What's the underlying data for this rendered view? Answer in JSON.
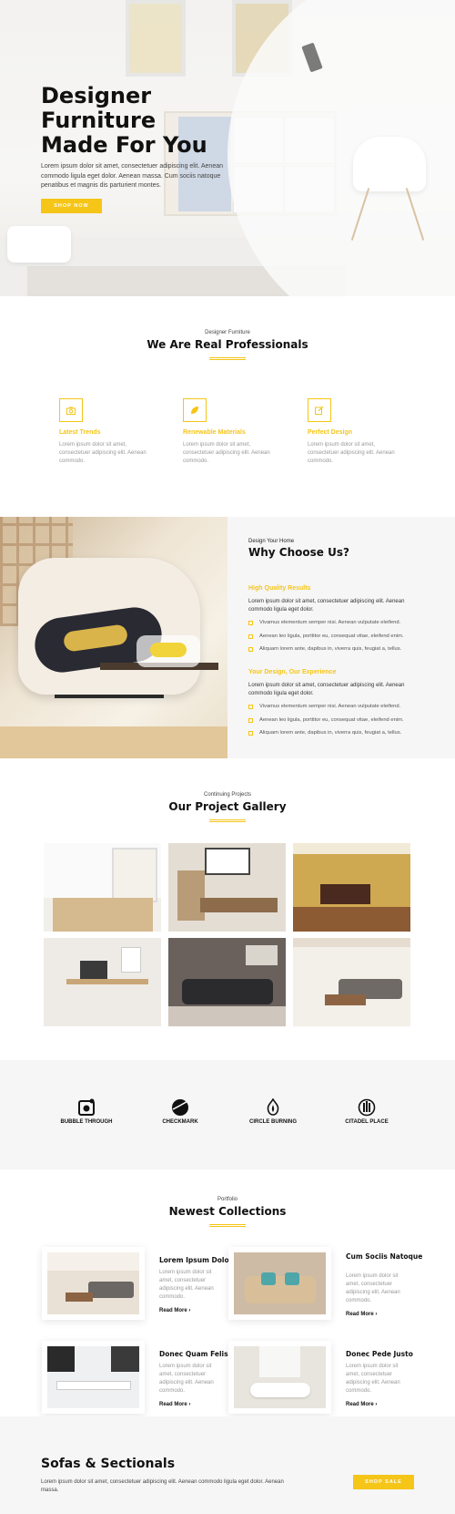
{
  "hero": {
    "title_line1": "Designer",
    "title_line2": "Furniture",
    "title_line3": "Made For You",
    "text": "Lorem ipsum dolor sit amet, consectetuer adipiscing elit. Aenean commodo ligula eget dolor. Aenean massa. Cum sociis natoque penatibus et magnis dis parturient montes.",
    "button": "Shop Now"
  },
  "professionals": {
    "kicker": "Designer Furniture",
    "title": "We Are Real Professionals",
    "features": [
      {
        "icon": "camera-icon",
        "title": "Latest Trends",
        "text": "Lorem ipsum dolor sit amet, consectetuer adipiscing elit. Aenean commodo."
      },
      {
        "icon": "leaf-icon",
        "title": "Renewable Materials",
        "text": "Lorem ipsum dolor sit amet, consectetuer adipiscing elit. Aenean commodo."
      },
      {
        "icon": "edit-icon",
        "title": "Perfect Design",
        "text": "Lorem ipsum dolor sit amet, consectetuer adipiscing elit. Aenean commodo."
      }
    ]
  },
  "why": {
    "kicker": "Design Your Home",
    "title": "Why Choose Us?",
    "blocks": [
      {
        "subtitle": "High Quality Results",
        "desc": "Lorem ipsum dolor sit amet, consectetuer adipiscing elit. Aenean commodo ligula eget dolor.",
        "items": [
          "Vivamus elementum semper nisi. Aenean vulputate eleifend.",
          "Aenean leo ligula, porttitor eu, consequat vitae, eleifend enim.",
          "Aliquam lorem ante, dapibus in, viverra quis, feugiat a, tellus."
        ]
      },
      {
        "subtitle": "Your Design, Our Experience",
        "desc": "Lorem ipsum dolor sit amet, consectetuer adipiscing elit. Aenean commodo ligula eget dolor.",
        "items": [
          "Vivamus elementum semper nisi. Aenean vulputate eleifend.",
          "Aenean leo ligula, porttitor eu, consequat vitae, eleifend enim.",
          "Aliquam lorem ante, dapibus in, viverra quis, feugiat a, tellus."
        ]
      }
    ]
  },
  "gallery": {
    "kicker": "Continuing Projects",
    "title": "Our Project Gallery"
  },
  "logos": [
    {
      "name": "BUBBLE THROUGH",
      "icon": "camera-logo-icon"
    },
    {
      "name": "CHECKMARK",
      "icon": "globe-check-icon"
    },
    {
      "name": "CIRCLE BURNING",
      "icon": "flame-icon"
    },
    {
      "name": "CITADEL PLACE",
      "icon": "citadel-icon"
    }
  ],
  "collections": {
    "kicker": "Portfolio",
    "title": "Newest Collections",
    "items": [
      {
        "title": "Lorem Ipsum Dolor",
        "text": "Lorem ipsum dolor sit amet, consectetuer adipiscing elit. Aenean commodo.",
        "more": "Read More"
      },
      {
        "title": "Cum Sociis Natoque",
        "text": "Lorem ipsum dolor sit amet, consectetuer adipiscing elit. Aenean commodo.",
        "more": "Read More"
      },
      {
        "title": "Donec Quam Felis",
        "text": "Lorem ipsum dolor sit amet, consectetuer adipiscing elit. Aenean commodo.",
        "more": "Read More"
      },
      {
        "title": "Donec Pede Justo",
        "text": "Lorem ipsum dolor sit amet, consectetuer adipiscing elit. Aenean commodo.",
        "more": "Read More"
      }
    ]
  },
  "cta": {
    "title": "Sofas & Sectionals",
    "text": "Lorem ipsum dolor sit amet, consectetuer adipiscing elit. Aenean commodo ligula eget dolor. Aenean massa.",
    "button": "Shop Sale"
  },
  "colors": {
    "accent": "#f5c518",
    "dark": "#111111",
    "muted": "#999999",
    "section_bg": "#f6f6f6"
  }
}
